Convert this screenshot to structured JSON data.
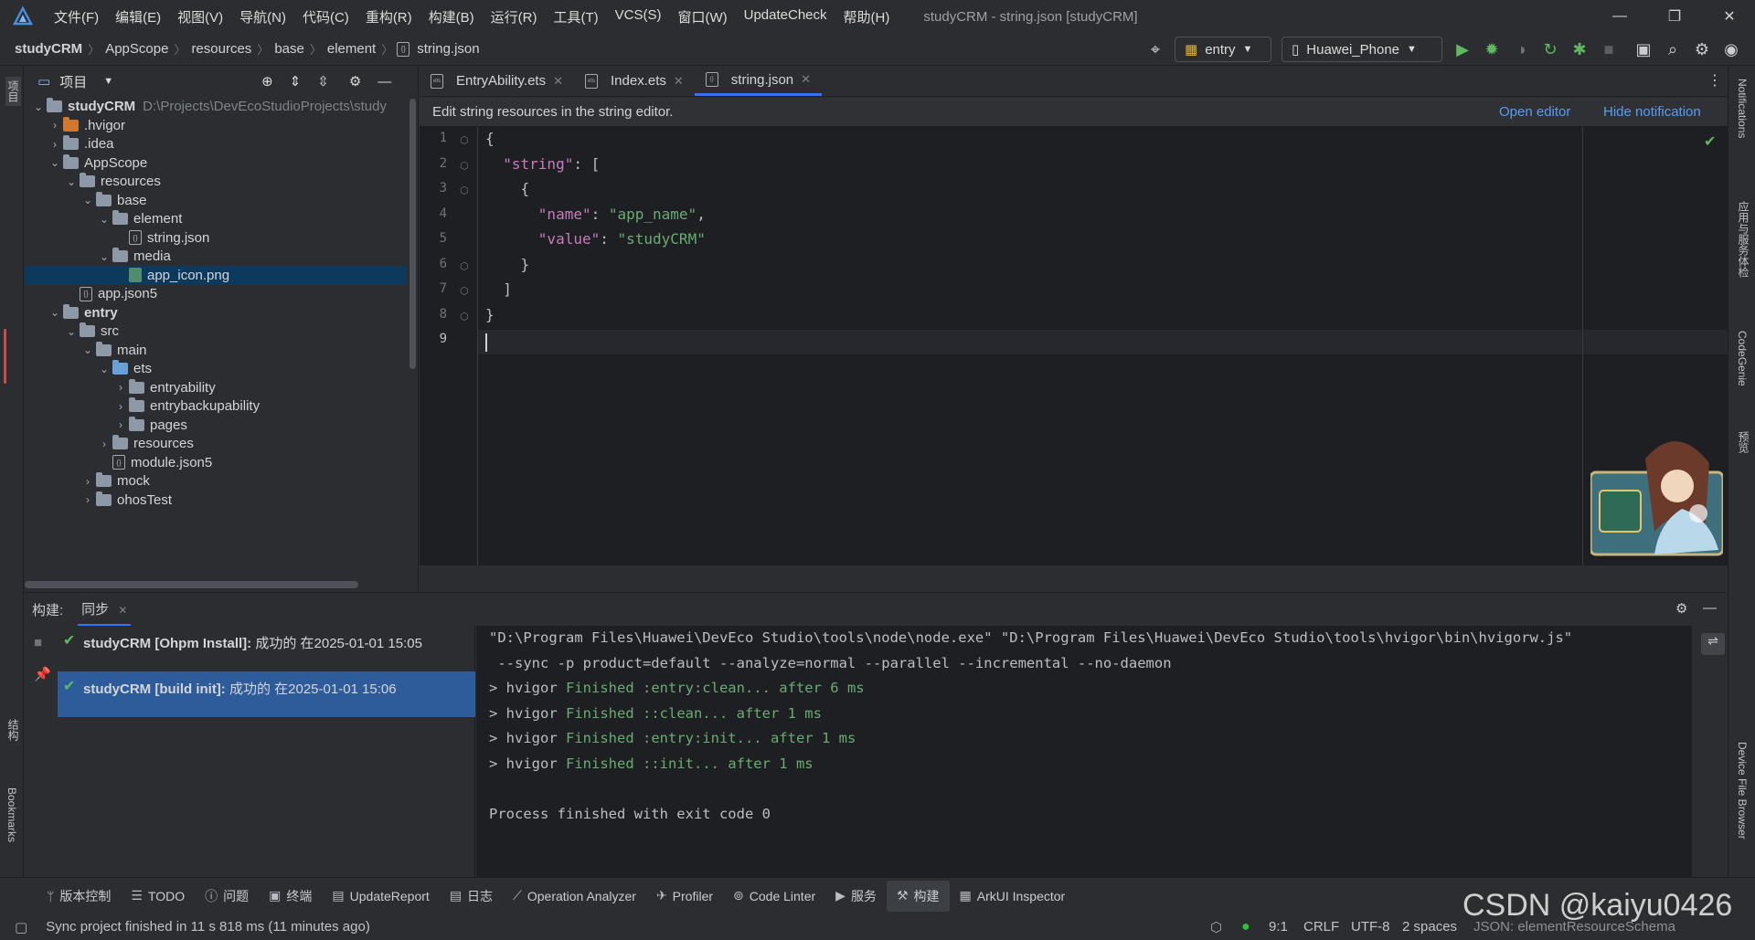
{
  "menubar": {
    "items": [
      "文件(F)",
      "编辑(E)",
      "视图(V)",
      "导航(N)",
      "代码(C)",
      "重构(R)",
      "构建(B)",
      "运行(R)",
      "工具(T)",
      "VCS(S)",
      "窗口(W)",
      "UpdateCheck",
      "帮助(H)"
    ],
    "title": "studyCRM - string.json [studyCRM]"
  },
  "breadcrumb": [
    "studyCRM",
    "AppScope",
    "resources",
    "base",
    "element",
    "string.json"
  ],
  "run_config": {
    "module": "entry",
    "device": "Huawei_Phone"
  },
  "project_panel": {
    "title": "项目",
    "tree": [
      {
        "label": "studyCRM",
        "path": "D:\\Projects\\DevEcoStudioProjects\\study",
        "indent": 0,
        "kind": "module",
        "open": true,
        "bold": true
      },
      {
        "label": ".hvigor",
        "indent": 1,
        "kind": "orange",
        "open": false
      },
      {
        "label": ".idea",
        "indent": 1,
        "kind": "folder",
        "open": false
      },
      {
        "label": "AppScope",
        "indent": 1,
        "kind": "folder",
        "open": true
      },
      {
        "label": "resources",
        "indent": 2,
        "kind": "folder",
        "open": true
      },
      {
        "label": "base",
        "indent": 3,
        "kind": "folder",
        "open": true
      },
      {
        "label": "element",
        "indent": 4,
        "kind": "folder",
        "open": true
      },
      {
        "label": "string.json",
        "indent": 5,
        "kind": "file"
      },
      {
        "label": "media",
        "indent": 4,
        "kind": "folder",
        "open": true
      },
      {
        "label": "app_icon.png",
        "indent": 5,
        "kind": "image",
        "selected": true
      },
      {
        "label": "app.json5",
        "indent": 2,
        "kind": "file"
      },
      {
        "label": "entry",
        "indent": 1,
        "kind": "module",
        "open": true,
        "bold": true
      },
      {
        "label": "src",
        "indent": 2,
        "kind": "folder",
        "open": true
      },
      {
        "label": "main",
        "indent": 3,
        "kind": "folder",
        "open": true
      },
      {
        "label": "ets",
        "indent": 4,
        "kind": "blue",
        "open": true
      },
      {
        "label": "entryability",
        "indent": 5,
        "kind": "folder",
        "open": false
      },
      {
        "label": "entrybackupability",
        "indent": 5,
        "kind": "folder",
        "open": false
      },
      {
        "label": "pages",
        "indent": 5,
        "kind": "folder",
        "open": false
      },
      {
        "label": "resources",
        "indent": 4,
        "kind": "folder",
        "open": false
      },
      {
        "label": "module.json5",
        "indent": 4,
        "kind": "file"
      },
      {
        "label": "mock",
        "indent": 3,
        "kind": "folder",
        "open": false
      },
      {
        "label": "ohosTest",
        "indent": 3,
        "kind": "folder",
        "open": false
      }
    ]
  },
  "tabs": [
    {
      "label": "EntryAbility.ets",
      "active": false
    },
    {
      "label": "Index.ets",
      "active": false
    },
    {
      "label": "string.json",
      "active": true
    }
  ],
  "notice": {
    "text": "Edit string resources in the string editor.",
    "open_editor": "Open editor",
    "hide": "Hide notification"
  },
  "code": {
    "line_numbers": [
      "1",
      "2",
      "3",
      "4",
      "5",
      "6",
      "7",
      "8",
      "9"
    ],
    "lines": [
      [
        {
          "t": "{",
          "c": ""
        }
      ],
      [
        {
          "t": "  ",
          "c": ""
        },
        {
          "t": "\"string\"",
          "c": "k"
        },
        {
          "t": ": [",
          "c": ""
        }
      ],
      [
        {
          "t": "    {",
          "c": ""
        }
      ],
      [
        {
          "t": "      ",
          "c": ""
        },
        {
          "t": "\"name\"",
          "c": "k"
        },
        {
          "t": ": ",
          "c": ""
        },
        {
          "t": "\"app_name\"",
          "c": "s"
        },
        {
          "t": ",",
          "c": ""
        }
      ],
      [
        {
          "t": "      ",
          "c": ""
        },
        {
          "t": "\"value\"",
          "c": "k"
        },
        {
          "t": ": ",
          "c": ""
        },
        {
          "t": "\"studyCRM\"",
          "c": "s"
        }
      ],
      [
        {
          "t": "    }",
          "c": ""
        }
      ],
      [
        {
          "t": "  ]",
          "c": ""
        }
      ],
      [
        {
          "t": "}",
          "c": ""
        }
      ],
      [
        {
          "t": "",
          "c": ""
        }
      ]
    ]
  },
  "build_panel": {
    "label": "构建:",
    "tab": "同步",
    "items": [
      {
        "title": "studyCRM [Ohpm Install]:",
        "status": " 成功的 在2025-01-01 15:05",
        "selected": false
      },
      {
        "title": "studyCRM [build init]:",
        "status": " 成功的 在2025-01-01 15:06",
        "selected": true
      }
    ],
    "console": [
      {
        "text": "\"D:\\Program Files\\Huawei\\DevEco Studio\\tools\\node\\node.exe\" \"D:\\Program Files\\Huawei\\DevEco Studio\\tools\\hvigor\\bin\\hvigorw.js\"",
        "green": ""
      },
      {
        "text": " --sync -p product=default --analyze=normal --parallel --incremental --no-daemon",
        "green": ""
      },
      {
        "text": "> hvigor ",
        "green": "Finished :entry:clean... after 6 ms"
      },
      {
        "text": "> hvigor ",
        "green": "Finished ::clean... after 1 ms"
      },
      {
        "text": "> hvigor ",
        "green": "Finished :entry:init... after 1 ms"
      },
      {
        "text": "> hvigor ",
        "green": "Finished ::init... after 1 ms"
      },
      {
        "text": "",
        "green": ""
      },
      {
        "text": "Process finished with exit code 0",
        "green": ""
      }
    ]
  },
  "left_strip": {
    "project": "项目",
    "structure": "结构",
    "bookmarks": "Bookmarks"
  },
  "right_strip": {
    "notifications": "Notifications",
    "app_services": "应用与服务体检",
    "codegenie": "CodeGenie",
    "preview": "预览",
    "device_browser": "Device File Browser"
  },
  "tool_windows": [
    {
      "label": "版本控制",
      "icon": "branch-icon"
    },
    {
      "label": "TODO",
      "icon": "list-icon"
    },
    {
      "label": "问题",
      "icon": "info-icon"
    },
    {
      "label": "终端",
      "icon": "terminal-icon"
    },
    {
      "label": "UpdateReport",
      "icon": "report-icon"
    },
    {
      "label": "日志",
      "icon": "log-icon"
    },
    {
      "label": "Operation Analyzer",
      "icon": "chart-icon"
    },
    {
      "label": "Profiler",
      "icon": "profiler-icon"
    },
    {
      "label": "Code Linter",
      "icon": "linter-icon"
    },
    {
      "label": "服务",
      "icon": "play-icon"
    },
    {
      "label": "构建",
      "icon": "hammer-icon",
      "active": true
    },
    {
      "label": "ArkUI Inspector",
      "icon": "inspector-icon"
    }
  ],
  "status": {
    "message": "Sync project finished in 11 s 818 ms (11 minutes ago)",
    "position": "9:1",
    "line_sep": "CRLF",
    "encoding": "UTF-8",
    "indent": "2 spaces",
    "schema": "JSON: elementResourceSchema"
  },
  "watermark": "CSDN @kaiyu0426",
  "colors": {
    "accent": "#3574f0",
    "selection": "#2e5b9a",
    "success": "#5fb85f",
    "string": "#6aab73",
    "key": "#c77dbb"
  }
}
